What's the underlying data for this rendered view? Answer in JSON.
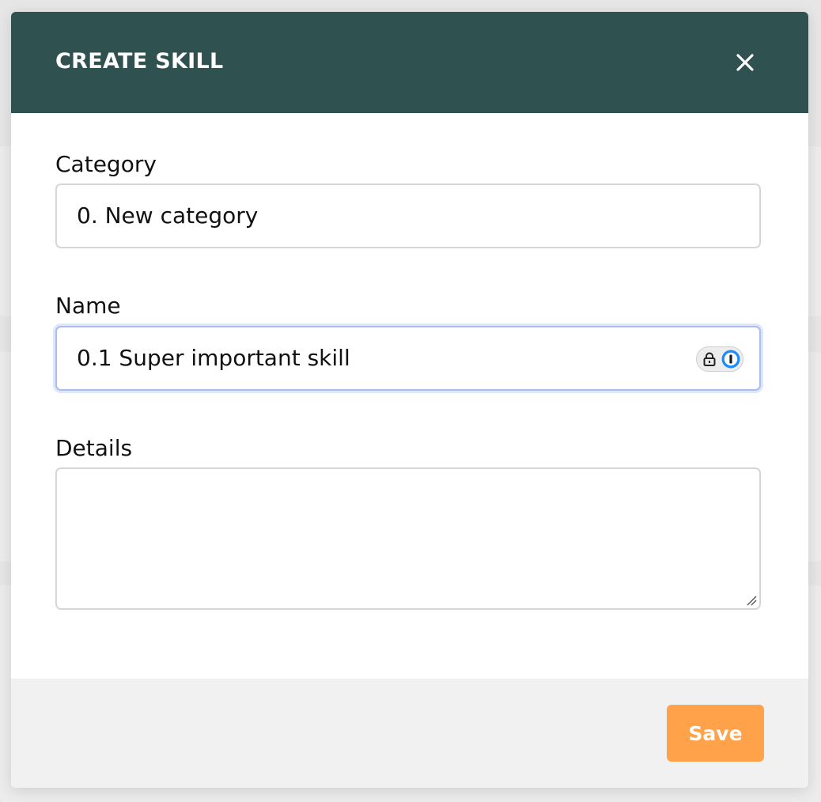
{
  "modal": {
    "title": "CREATE SKILL",
    "close_icon": "close-icon"
  },
  "form": {
    "category": {
      "label": "Category",
      "value": "0. New category"
    },
    "name": {
      "label": "Name",
      "value": "0.1 Super important skill",
      "extension_icons": [
        "lock-icon",
        "password-manager-icon"
      ]
    },
    "details": {
      "label": "Details",
      "value": ""
    }
  },
  "footer": {
    "save_label": "Save"
  },
  "colors": {
    "header_bg": "#2f514f",
    "save_bg": "#ffa24a",
    "footer_bg": "#f1f1f1",
    "focus_border": "#a9bdf0"
  }
}
